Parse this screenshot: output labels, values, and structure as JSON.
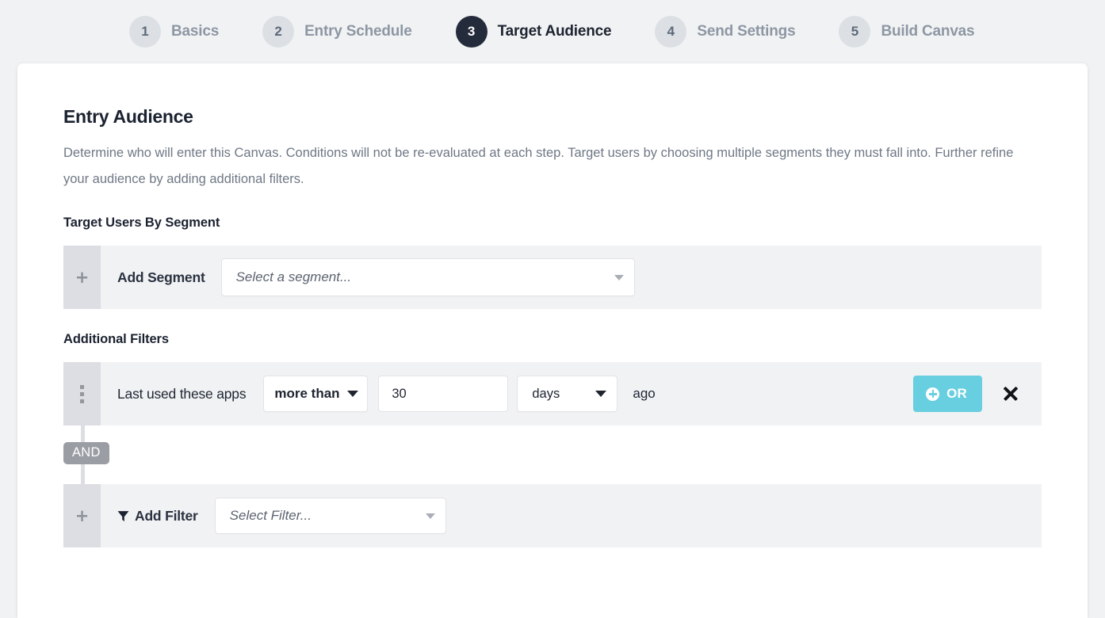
{
  "stepper": {
    "steps": [
      {
        "number": "1",
        "label": "Basics",
        "active": false
      },
      {
        "number": "2",
        "label": "Entry Schedule",
        "active": false
      },
      {
        "number": "3",
        "label": "Target Audience",
        "active": true
      },
      {
        "number": "4",
        "label": "Send Settings",
        "active": false
      },
      {
        "number": "5",
        "label": "Build Canvas",
        "active": false
      }
    ]
  },
  "card": {
    "title": "Entry Audience",
    "description": "Determine who will enter this Canvas. Conditions will not be re-evaluated at each step. Target users by choosing multiple segments they must fall into. Further refine your audience by adding additional filters.",
    "segment_section": {
      "heading": "Target Users By Segment",
      "add_label": "Add Segment",
      "add_icon": "plus-icon",
      "select": {
        "value": "",
        "placeholder": "Select a segment...",
        "caret_icon": "chevron-down-icon"
      }
    },
    "filters_section": {
      "heading": "Additional Filters",
      "connector_label": "AND",
      "filter_row": {
        "drag_icon": "drag-handle-icon",
        "label": "Last used these apps",
        "operator": {
          "value": "more than",
          "caret_icon": "chevron-down-icon"
        },
        "amount": {
          "value": "30",
          "placeholder": ""
        },
        "unit": {
          "value": "days",
          "caret_icon": "chevron-down-icon"
        },
        "suffix": "ago",
        "or_button": {
          "label": "OR",
          "icon": "plus-circle-icon",
          "color": "#68cfe0"
        },
        "remove_icon": "close-icon"
      },
      "add_filter_row": {
        "add_icon": "plus-icon",
        "funnel_icon": "funnel-icon",
        "label": "Add Filter",
        "select": {
          "value": "",
          "placeholder": "Select Filter...",
          "caret_icon": "chevron-down-icon"
        }
      }
    }
  }
}
